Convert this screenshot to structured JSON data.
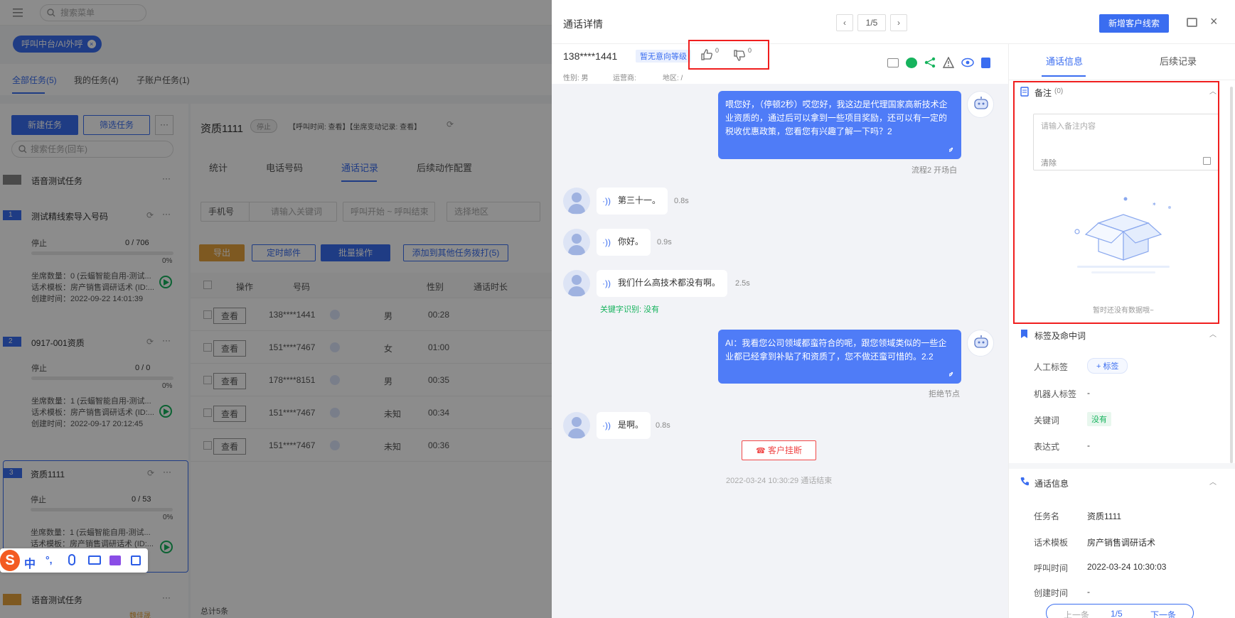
{
  "bg": {
    "menu_search_placeholder": "搜索菜单",
    "route_tag": "呼叫中台/AI外呼",
    "tabs": [
      "全部任务(5)",
      "我的任务(4)",
      "子账户任务(1)"
    ],
    "new_task": "新建任务",
    "filter_task": "筛选任务",
    "search_task_placeholder": "搜索任务(回车)",
    "tasks": [
      {
        "title": "语音测试任务"
      },
      {
        "num": "1",
        "title": "测试精线索导入号码",
        "status": "停止",
        "count": "0 / 706",
        "pct": "0%",
        "seats": "坐席数量：0 (云蝠智能自用-测试...",
        "script": "话术模板：房产销售调研话术 (ID:...",
        "created": "创建时间：2022-09-22 14:01:39"
      },
      {
        "num": "2",
        "title": "0917-001资质",
        "status": "停止",
        "count": "0 / 0",
        "pct": "0%",
        "seats": "坐席数量：1 (云蝠智能自用-测试...",
        "script": "话术模板：房产销售调研话术 (ID:...",
        "created": "创建时间：2022-09-17 20:12:45"
      },
      {
        "num": "3",
        "title": "资质1111",
        "status": "停止",
        "count": "0 / 53",
        "pct": "0%",
        "seats": "坐席数量：1 (云蝠智能自用-测试...",
        "script": "话术模板：房产销售调研话术 (ID:..."
      },
      {
        "title": "语音测试任务",
        "owner": "魏佳晟"
      }
    ],
    "main_title": "资质1111",
    "main_status": "停止",
    "main_links": "【呼叫时间: 查看】【坐席变动记录: 查看】",
    "subtabs": [
      "统计",
      "电话号码",
      "通话记录",
      "后续动作配置"
    ],
    "filter_phone": "手机号",
    "filter_keyword": "请输入关键词",
    "filter_time": "呼叫开始 ~ 呼叫结束",
    "filter_region": "选择地区",
    "export": "导出",
    "mail": "定时邮件",
    "batch": "批量操作",
    "add_to": "添加到其他任务拨打(5)",
    "table_headers": [
      "操作",
      "号码",
      "性别",
      "通话时长"
    ],
    "rows": [
      {
        "action": "查看",
        "phone": "138****1441",
        "gender": "男",
        "duration": "00:28"
      },
      {
        "action": "查看",
        "phone": "151****7467",
        "gender": "女",
        "duration": "01:00"
      },
      {
        "action": "查看",
        "phone": "178****8151",
        "gender": "男",
        "duration": "00:35"
      },
      {
        "action": "查看",
        "phone": "151****7467",
        "gender": "未知",
        "duration": "00:34"
      },
      {
        "action": "查看",
        "phone": "151****7467",
        "gender": "未知",
        "duration": "00:36"
      }
    ],
    "total": "总计5条",
    "ime": [
      "中",
      "°,"
    ]
  },
  "drawer": {
    "title": "通话详情",
    "pager": "1/5",
    "new_lead": "新增客户线索",
    "phone": "138****1441",
    "intent": "暂无意向等级",
    "like_count": "0",
    "dislike_count": "0",
    "gender": "性别: 男",
    "carrier": "运营商:",
    "region": "地区: /",
    "messages": {
      "ai1": "喂您好，（停顿2秒）哎您好，我这边是代理国家高新技术企业资质的，通过后可以拿到一些项目奖励，还可以有一定的税收优惠政策，您看您有兴趣了解一下吗？2",
      "ai1_node": "流程2 开场白",
      "u1": "第三十一。",
      "u1_dur": "0.8s",
      "u2": "你好。",
      "u2_dur": "0.9s",
      "u3": "我们什么高技术都没有啊。",
      "u3_dur": "2.5s",
      "u3_kw": "关键字识别: 没有",
      "ai2": "AI：我看您公司领域都蛮符合的呢，跟您领域类似的一些企业都已经拿到补贴了和资质了，您不做还蛮可惜的。2.2",
      "ai2_node": "拒绝节点",
      "u4": "是啊。",
      "u4_dur": "0.8s",
      "hangup": "客户挂断",
      "end": "2022-03-24 10:30:29 通话结束"
    },
    "side_tabs": [
      "通话信息",
      "后续记录"
    ],
    "notes": {
      "title": "备注",
      "count": "(0)",
      "placeholder": "请输入备注内容",
      "clear": "清除",
      "empty": "暂时还没有数据哦~"
    },
    "tags": {
      "title": "标签及命中词",
      "manual_k": "人工标签",
      "manual_btn": "+ 标签",
      "robot_k": "机器人标签",
      "robot_v": "-",
      "kw_k": "关键词",
      "kw_v": "没有",
      "expr_k": "表达式",
      "expr_v": "-"
    },
    "callinfo": {
      "title": "通话信息",
      "task_k": "任务名",
      "task_v": "资质1111",
      "script_k": "话术模板",
      "script_v": "房产销售调研话术",
      "calltime_k": "呼叫时间",
      "calltime_v": "2022-03-24 10:30:03",
      "created_k": "创建时间",
      "created_v": "-"
    },
    "bottom_pager": {
      "prev": "上一条",
      "page": "1/5",
      "next": "下一条"
    }
  },
  "colors": {
    "primary": "#3a6df0",
    "bubble": "#4f7cf7",
    "highlight": "#f01e1e",
    "green": "#16b35d",
    "danger": "#f04848"
  }
}
